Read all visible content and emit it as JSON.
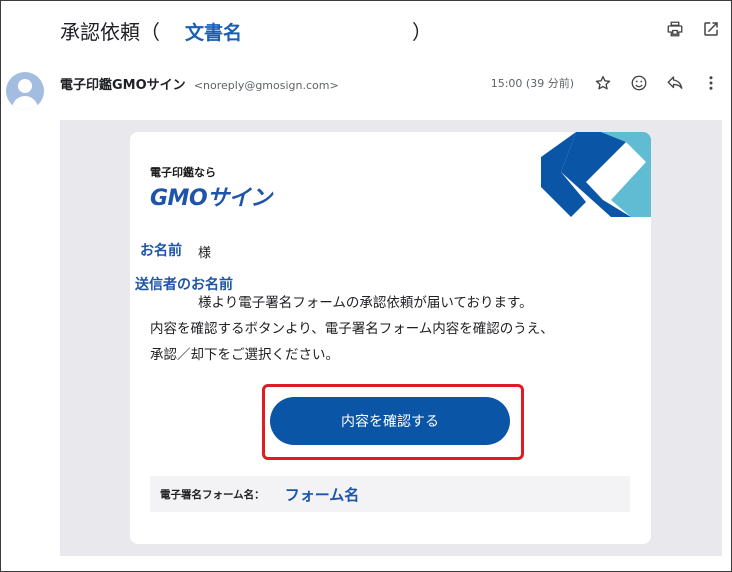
{
  "subject": {
    "prefix": "承認依頼（",
    "document_name": "文書名",
    "suffix": "）"
  },
  "toolbar": {
    "print_icon": "print-icon",
    "open_new_window_icon": "open-in-new-icon"
  },
  "sender": {
    "name": "電子印鑑GMOサイン",
    "email": "<noreply@gmosign.com>",
    "time": "15:00 (39 分前)"
  },
  "actions": {
    "star_icon": "star-icon",
    "emoji_icon": "emoji-icon",
    "reply_icon": "reply-icon",
    "more_icon": "more-vert-icon"
  },
  "email_body": {
    "logo_tagline": "電子印鑑なら",
    "logo_brand": "GMOサイン",
    "recipient_label": "お名前",
    "honorific": "様",
    "sender_label": "送信者のお名前",
    "message_lines": [
      "様より電子署名フォームの承認依頼が届いております。",
      "内容を確認するボタンより、電子署名フォーム内容を確認のうえ、",
      "承認／却下をご選択ください。"
    ],
    "confirm_button": "内容を確認する",
    "form_name_label": "電子署名フォーム名：",
    "form_name_value": "フォーム名"
  },
  "colors": {
    "brand_blue": "#0a55a6",
    "highlight_red": "#e01b24",
    "deco_light_blue": "#5fbcd3",
    "gray_background": "#e9e9ed"
  }
}
